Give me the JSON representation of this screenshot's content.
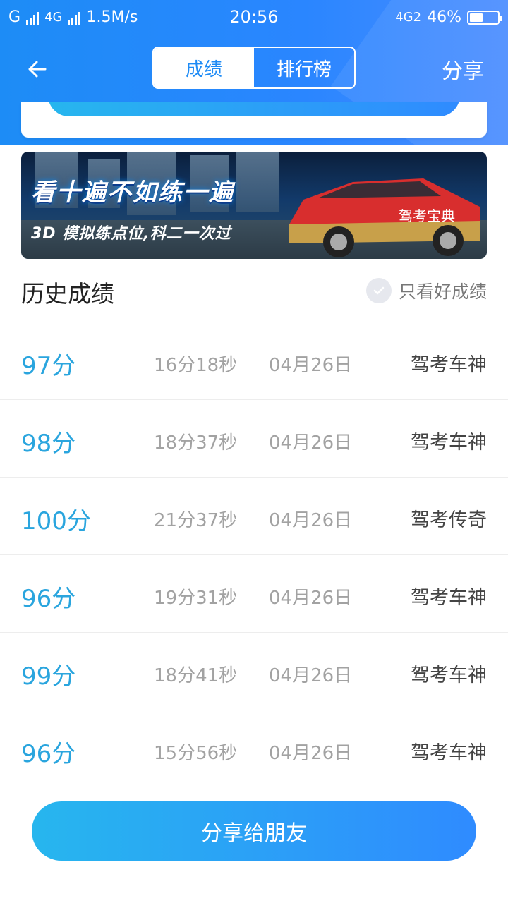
{
  "status_bar": {
    "carrier1": "G",
    "carrier2": "4G",
    "speed": "1.5M/s",
    "time": "20:56",
    "net": "4G2",
    "battery": "46%"
  },
  "nav": {
    "tabs": [
      {
        "label": "成绩"
      },
      {
        "label": "排行榜"
      }
    ],
    "share_label": "分享"
  },
  "banner": {
    "title": "看十遍不如练一遍",
    "subtitle": "3D 模拟练点位,科二一次过",
    "car_text": "驾考宝典"
  },
  "history": {
    "title": "历史成绩",
    "filter_label": "只看好成绩"
  },
  "records": [
    {
      "score": "97分",
      "duration": "16分18秒",
      "date": "04月26日",
      "rank": "驾考车神"
    },
    {
      "score": "98分",
      "duration": "18分37秒",
      "date": "04月26日",
      "rank": "驾考车神"
    },
    {
      "score": "100分",
      "duration": "21分37秒",
      "date": "04月26日",
      "rank": "驾考传奇"
    },
    {
      "score": "96分",
      "duration": "19分31秒",
      "date": "04月26日",
      "rank": "驾考车神"
    },
    {
      "score": "99分",
      "duration": "18分41秒",
      "date": "04月26日",
      "rank": "驾考车神"
    },
    {
      "score": "96分",
      "duration": "15分56秒",
      "date": "04月26日",
      "rank": "驾考车神"
    }
  ],
  "share_friends": "分享给朋友",
  "colors": {
    "header": "#1e8bf5",
    "score": "#2aa5de",
    "button_start": "#27b6ee",
    "button_end": "#2f8bff"
  }
}
